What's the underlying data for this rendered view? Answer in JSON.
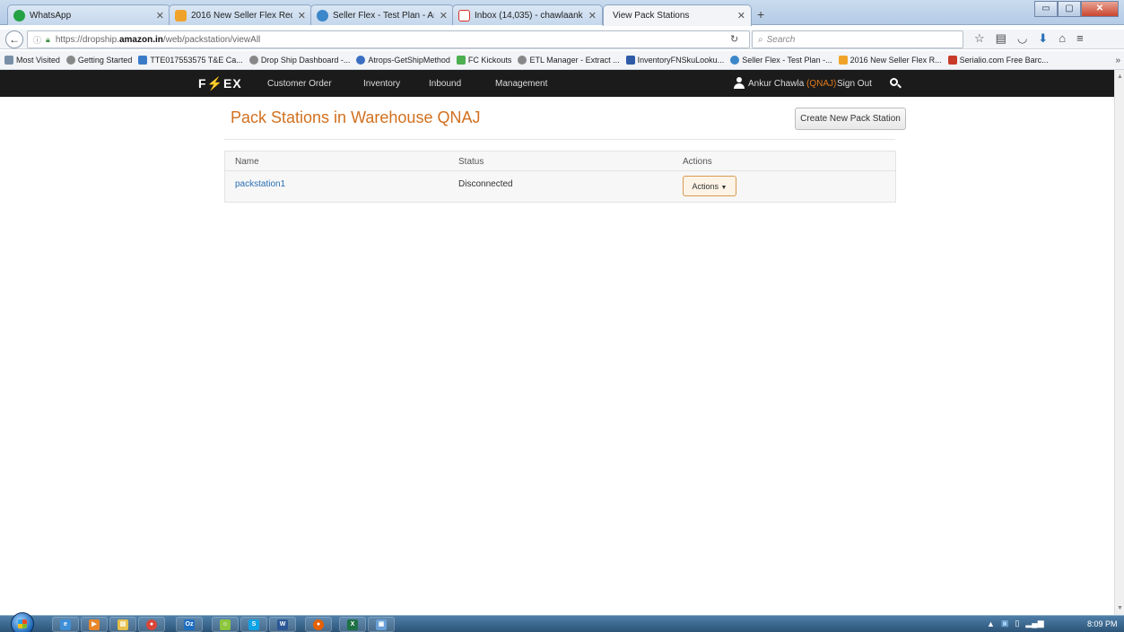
{
  "browser": {
    "tabs": [
      {
        "title": "WhatsApp",
        "icon": "whatsapp-icon",
        "color": "#25a244"
      },
      {
        "title": "2016 New Seller Flex Reque...",
        "icon": "office-icon",
        "color": "#f0a32a"
      },
      {
        "title": "Seller Flex - Test Plan - Am...",
        "icon": "wiki-icon",
        "color": "#3b87c9"
      },
      {
        "title": "Inbox (14,035) - chawlaank...",
        "icon": "gmail-icon",
        "color": "#d93025"
      },
      {
        "title": "View Pack Stations",
        "icon": "",
        "color": ""
      }
    ],
    "new_tab": "+",
    "url_prefix": "https://dropship.",
    "url_domain": "amazon.in",
    "url_path": "/web/packstation/viewAll",
    "search_placeholder": "Search",
    "bookmarks": [
      {
        "label": "Most Visited",
        "color": "#7a8fa8"
      },
      {
        "label": "Getting Started",
        "color": "#888"
      },
      {
        "label": "TTE017553575 T&E Ca...",
        "color": "#3a7bc8"
      },
      {
        "label": "Drop Ship Dashboard -...",
        "color": "#888"
      },
      {
        "label": "Atrops-GetShipMethod",
        "color": "#3a6ec2"
      },
      {
        "label": "FC Kickouts",
        "color": "#4caf50"
      },
      {
        "label": "ETL Manager - Extract ...",
        "color": "#888"
      },
      {
        "label": "InventoryFNSkuLooku...",
        "color": "#2f5aa8"
      },
      {
        "label": "Seller Flex - Test Plan -...",
        "color": "#3b87c9"
      },
      {
        "label": "2016 New Seller Flex R...",
        "color": "#f0a32a"
      },
      {
        "label": "Serialio.com Free Barc...",
        "color": "#c83a2a"
      }
    ],
    "bookmarks_more": "»"
  },
  "app": {
    "logo_left": "F",
    "logo_bolt": "⚡",
    "logo_right": "EX",
    "nav": [
      "Customer Order",
      "Inventory",
      "Inbound",
      "Management"
    ],
    "user_name": "Ankur Chawla",
    "warehouse_tag": "(QNAJ)",
    "sign_out": "Sign Out",
    "accent_color": "#d2701f"
  },
  "page": {
    "title": "Pack Stations in Warehouse QNAJ",
    "create_button": "Create New Pack Station",
    "columns": [
      "Name",
      "Status",
      "Actions"
    ],
    "rows": [
      {
        "name": "packstation1",
        "status": "Disconnected",
        "actions_label": "Actions"
      }
    ]
  },
  "taskbar": {
    "clock": "8:09 PM",
    "apps": [
      {
        "icon": "ie-icon",
        "color": "#3f8fd8",
        "label": "e"
      },
      {
        "icon": "media-icon",
        "color": "#e8862a",
        "label": "▶"
      },
      {
        "icon": "explorer-icon",
        "color": "#e6c04a",
        "label": "▤"
      },
      {
        "icon": "chrome-icon",
        "color": "#d9463a",
        "label": "●"
      },
      {
        "icon": "outlook-icon",
        "color": "#1f6fc1",
        "label": "Oz"
      },
      {
        "icon": "lync-icon",
        "color": "#8cc63f",
        "label": "☺"
      },
      {
        "icon": "skype-icon",
        "color": "#0fa3e6",
        "label": "S"
      },
      {
        "icon": "word-icon",
        "color": "#2b5797",
        "label": "W"
      },
      {
        "icon": "firefox-icon",
        "color": "#e66000",
        "label": "●"
      },
      {
        "icon": "excel-icon",
        "color": "#1e7145",
        "label": "X"
      },
      {
        "icon": "remote-icon",
        "color": "#6aa0d6",
        "label": "▣"
      }
    ]
  }
}
